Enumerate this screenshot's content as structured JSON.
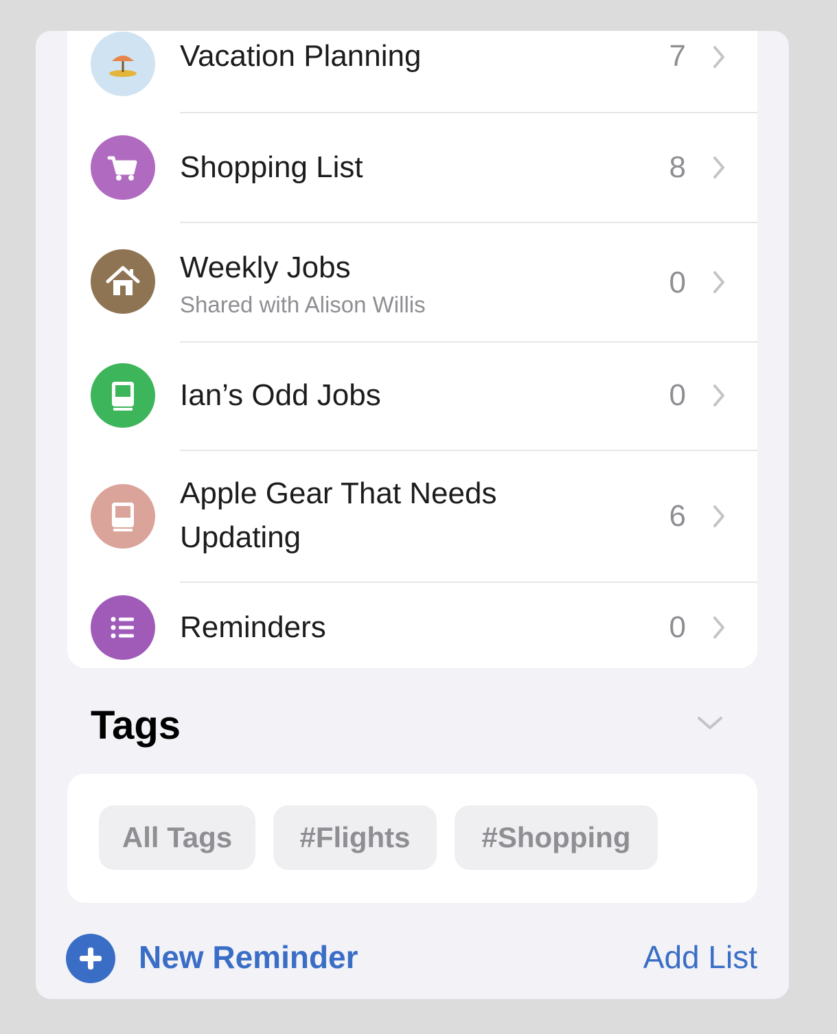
{
  "lists": [
    {
      "title": "Vacation Planning",
      "subtitle": "",
      "count": "7",
      "icon": "beach-umbrella-icon",
      "color": "#cfe3f2"
    },
    {
      "title": "Shopping List",
      "subtitle": "",
      "count": "8",
      "icon": "cart-icon",
      "color": "#b06ac0"
    },
    {
      "title": "Weekly Jobs",
      "subtitle": "Shared with Alison Willis",
      "count": "0",
      "icon": "house-icon",
      "color": "#8e7453"
    },
    {
      "title": "Ian’s Odd Jobs",
      "subtitle": "",
      "count": "0",
      "icon": "computer-icon",
      "color": "#3db55a"
    },
    {
      "title": "Apple Gear That Needs Updating",
      "subtitle": "",
      "count": "6",
      "icon": "computer-icon",
      "color": "#dba49a"
    },
    {
      "title": "Reminders",
      "subtitle": "",
      "count": "0",
      "icon": "list-bullets-icon",
      "color": "#a05bb9"
    }
  ],
  "tags": {
    "header": "Tags",
    "chips": [
      "All Tags",
      "#Flights",
      "#Shopping"
    ]
  },
  "toolbar": {
    "new_reminder": "New Reminder",
    "add_list": "Add List"
  },
  "colors": {
    "accent": "#3a6ec6",
    "background": "#f2f2f7"
  }
}
